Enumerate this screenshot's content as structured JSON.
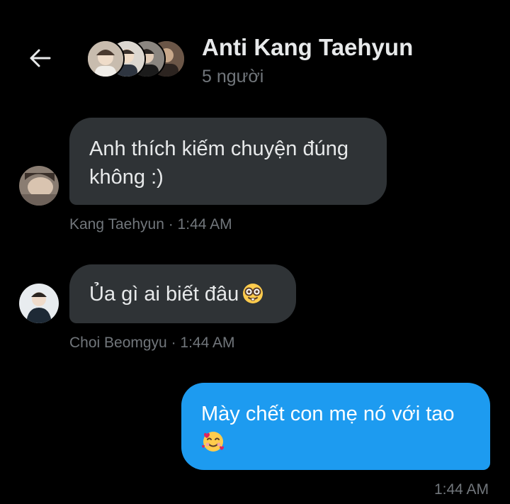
{
  "header": {
    "back_icon": "arrow-left-icon",
    "title": "Anti Kang Taehyun",
    "subtitle": "5 người"
  },
  "messages": [
    {
      "sender": "Kang Taehyun",
      "text": "Anh thích kiếm chuyện đúng không :)",
      "meta": "Kang Taehyun · 1:44 AM",
      "direction": "incoming"
    },
    {
      "sender": "Choi Beomgyu",
      "text": "Ủa gì ai biết đâu",
      "emoji": "nerd-face-emoji",
      "meta": "Choi Beomgyu · 1:44 AM",
      "direction": "incoming"
    },
    {
      "sender": "me",
      "text": "Mày chết con mẹ nó với tao",
      "emoji": "smiling-face-with-hearts-emoji",
      "meta": "1:44 AM",
      "direction": "outgoing"
    }
  ],
  "colors": {
    "background": "#000000",
    "incoming_bubble": "#2f3336",
    "outgoing_bubble": "#1d9bf0",
    "muted_text": "#71767b",
    "primary_text": "#e7e9ea"
  }
}
